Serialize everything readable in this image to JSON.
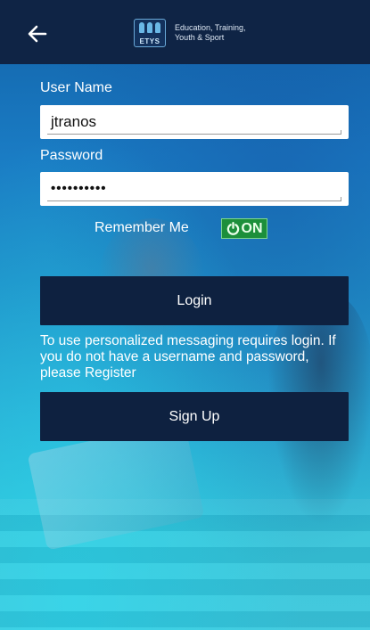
{
  "header": {
    "logo_abbr": "ETYS",
    "logo_line1": "Education, Training,",
    "logo_line2": "Youth & Sport",
    "back_icon": "arrow-left-icon"
  },
  "login_form": {
    "username_label": "User Name",
    "username_value": "jtranos",
    "password_label": "Password",
    "password_value": "••••••••••",
    "remember_label": "Remember Me",
    "remember_toggle_text": "ON",
    "remember_on": true,
    "login_button": "Login",
    "info_text": "To use personalized messaging requires login. If you do not have a username and password, please Register",
    "signup_button": "Sign Up"
  },
  "colors": {
    "header_bg": "#0f2445",
    "button_bg": "#0e2140",
    "toggle_on": "#1c8f3b",
    "bg_top": "#1262a8",
    "bg_bottom": "#3ac7dc"
  }
}
